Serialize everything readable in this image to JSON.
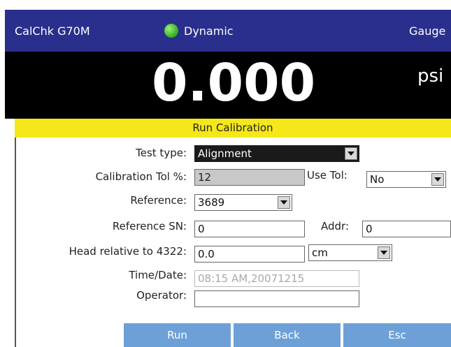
{
  "titlebar": {
    "device": "CalChk G70M",
    "mode": "Dynamic",
    "gauge": "Gauge",
    "status_color": "#3fb52a"
  },
  "reading": {
    "value": "0.000",
    "unit": "psi"
  },
  "dialog": {
    "title": "Run Calibration",
    "test_type": {
      "label": "Test type:",
      "value": "Alignment"
    },
    "calibration_tol": {
      "label": "Calibration Tol %:",
      "value": "12"
    },
    "use_tol": {
      "label": "Use Tol:",
      "value": "No"
    },
    "reference": {
      "label": "Reference:",
      "value": "3689"
    },
    "reference_sn": {
      "label": "Reference SN:",
      "value": "0"
    },
    "addr": {
      "label": "Addr:",
      "value": "0"
    },
    "head_relative": {
      "label": "Head relative to 4322:",
      "value": "0.0",
      "unit": "cm"
    },
    "time_date": {
      "label": "Time/Date:",
      "value": "08:15 AM,20071215"
    },
    "operator": {
      "label": "Operator:",
      "value": ""
    },
    "buttons": {
      "run": "Run",
      "back": "Back",
      "esc": "Esc"
    }
  },
  "colors": {
    "titlebar": "#2a2e8c",
    "dialog_title": "#f5e71a",
    "button": "#6ea0d8"
  }
}
